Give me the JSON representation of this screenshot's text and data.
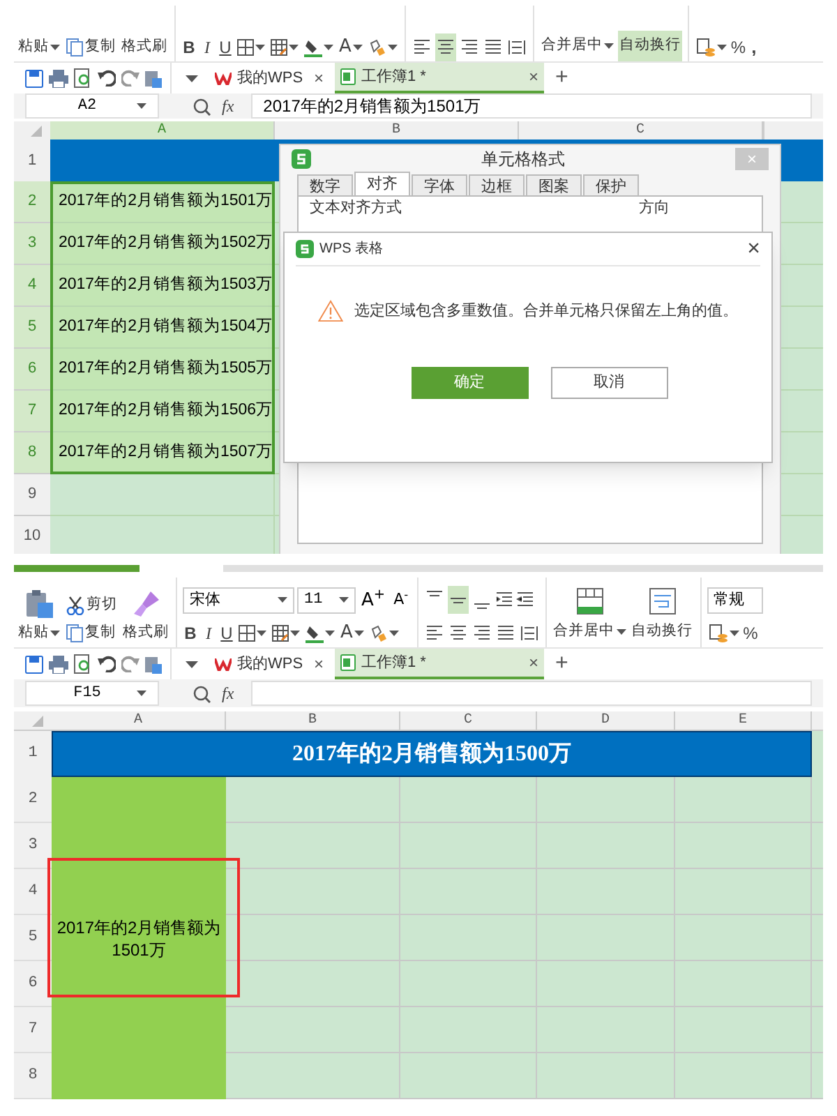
{
  "panels": [
    {
      "ribbon": {
        "clipboard": [
          {
            "kind": "paste",
            "label": "粘贴",
            "dropdown": true
          },
          {
            "kind": "copy",
            "label": "复制"
          },
          {
            "kind": "brush",
            "label": "格式刷"
          }
        ],
        "format_buttons": [
          "B",
          "I",
          "U"
        ],
        "font_color": "A",
        "align_buttons": [
          {
            "pressed": false
          },
          {
            "pressed": true
          },
          {
            "pressed": false
          },
          {
            "pressed": false
          },
          {
            "pressed": false
          }
        ],
        "merge": {
          "label": "合并居中",
          "dropdown": true
        },
        "wrap": {
          "label": "自动换行",
          "pressed": true
        },
        "percent": "%",
        "thousands": ","
      },
      "tabs": [
        {
          "kind": "wps",
          "label": "我的WPS",
          "close": "×",
          "selected": false
        },
        {
          "kind": "sheet",
          "label": "工作簿1 *",
          "close": "×",
          "selected": true
        }
      ],
      "new_tab": "+",
      "formula_bar": {
        "cell_ref": "A2",
        "fx": "fx",
        "formula": "2017年的2月销售额为1501万"
      },
      "grid": {
        "columns": [
          {
            "label": "A",
            "selected": true
          },
          {
            "label": "B",
            "selected": false
          },
          {
            "label": "C",
            "selected": false
          }
        ],
        "title_row": {
          "label": "1"
        },
        "rows": [
          {
            "label": "2",
            "selected": true,
            "cell": "2017年的2月销售额为1501万"
          },
          {
            "label": "3",
            "selected": true,
            "cell": "2017年的2月销售额为1502万"
          },
          {
            "label": "4",
            "selected": true,
            "cell": "2017年的2月销售额为1503万"
          },
          {
            "label": "5",
            "selected": true,
            "cell": "2017年的2月销售额为1504万"
          },
          {
            "label": "6",
            "selected": true,
            "cell": "2017年的2月销售额为1505万"
          },
          {
            "label": "7",
            "selected": true,
            "cell": "2017年的2月销售额为1506万"
          },
          {
            "label": "8",
            "selected": true,
            "cell": "2017年的2月销售额为1507万"
          },
          {
            "label": "9",
            "selected": false
          },
          {
            "label": "10",
            "selected": false
          }
        ]
      },
      "format_dialog": {
        "title": "单元格格式",
        "close": "×",
        "tabs": [
          {
            "label": "数字",
            "selected": false
          },
          {
            "label": "对齐",
            "selected": true
          },
          {
            "label": "字体",
            "selected": false
          },
          {
            "label": "边框",
            "selected": false
          },
          {
            "label": "图案",
            "selected": false
          },
          {
            "label": "保护",
            "selected": false
          }
        ],
        "section": "文本对齐方式",
        "direction": "方向"
      },
      "alert": {
        "title": "WPS 表格",
        "close": "×",
        "message": "选定区域包含多重数值。合并单元格只保留左上角的值。",
        "buttons": [
          {
            "label": "确定",
            "primary": true
          },
          {
            "label": "取消",
            "primary": false
          }
        ]
      }
    },
    {
      "ribbon": {
        "clipboard": [
          {
            "kind": "paste",
            "label": "粘贴",
            "dropdown": true
          },
          {
            "kind": "cut",
            "label": "剪切"
          },
          {
            "kind": "copy",
            "label": "复制"
          },
          {
            "kind": "brush",
            "label": "格式刷"
          }
        ],
        "font_name": "宋体",
        "font_size": "11",
        "grow": "A$^{+}$",
        "shrink": "A$^{-}$",
        "format_buttons": [
          "B",
          "I",
          "U"
        ],
        "font_color": "A",
        "valign_buttons": [
          {
            "pressed": false
          },
          {
            "pressed": true
          },
          {
            "pressed": false
          }
        ],
        "align_buttons": [
          {
            "pressed": false
          },
          {
            "pressed": false
          },
          {
            "pressed": false
          },
          {
            "pressed": false
          },
          {
            "pressed": false
          }
        ],
        "merge": {
          "label": "合并居中",
          "dropdown": true
        },
        "wrap": {
          "label": "自动换行",
          "pressed": false
        },
        "number_format": "常规",
        "percent": "%"
      },
      "tabs": [
        {
          "kind": "wps",
          "label": "我的WPS",
          "close": "×",
          "selected": false
        },
        {
          "kind": "sheet",
          "label": "工作簿1 *",
          "close": "×",
          "selected": true
        }
      ],
      "new_tab": "+",
      "formula_bar": {
        "cell_ref": "F15",
        "fx": "fx"
      },
      "grid": {
        "columns": [
          {
            "label": "A",
            "selected": false
          },
          {
            "label": "B",
            "selected": false
          },
          {
            "label": "C",
            "selected": false
          },
          {
            "label": "D",
            "selected": false
          },
          {
            "label": "E",
            "selected": false
          }
        ],
        "title_row": {
          "label": "1",
          "title": "2017年的2月销售额为1500万"
        },
        "row_labels": [
          "2",
          "3",
          "4",
          "5",
          "6",
          "7",
          "8"
        ],
        "merged_cell": "2017年的2月销售额为1501万"
      }
    }
  ]
}
